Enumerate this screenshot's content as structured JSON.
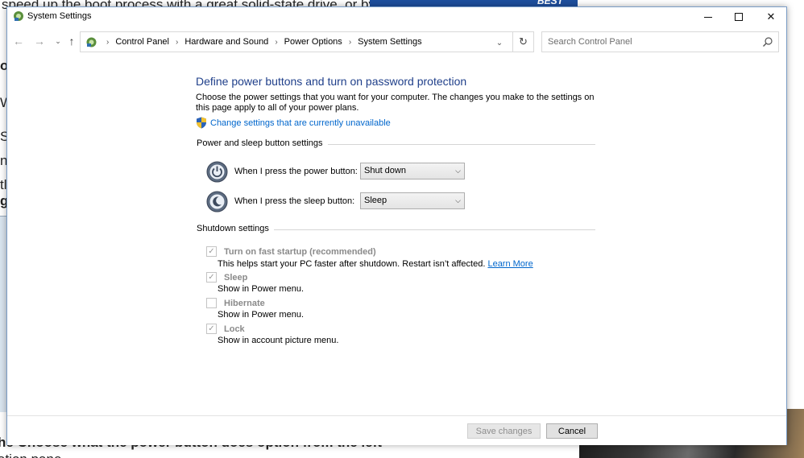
{
  "background": {
    "top_text": "speed up the boot process with a great solid-state drive, or by",
    "banner_text": "BEST",
    "bottom_line1": "he Choose what the power button does option from the left",
    "bottom_line2": "ation pane.",
    "left_fragments": [
      "o",
      "W",
      "S",
      "n",
      "tl",
      "gs"
    ]
  },
  "window": {
    "title": "System Settings",
    "controls": {
      "minimize": "minimize",
      "maximize": "maximize",
      "close": "✕"
    }
  },
  "nav": {
    "breadcrumbs": [
      "Control Panel",
      "Hardware and Sound",
      "Power Options",
      "System Settings"
    ],
    "search_placeholder": "Search Control Panel"
  },
  "main": {
    "title": "Define power buttons and turn on password protection",
    "description": "Choose the power settings that you want for your computer. The changes you make to the settings on this page apply to all of your power plans.",
    "change_link": "Change settings that are currently unavailable",
    "power_section": {
      "header": "Power and sleep button settings",
      "power_button_label": "When I press the power button:",
      "power_button_value": "Shut down",
      "sleep_button_label": "When I press the sleep button:",
      "sleep_button_value": "Sleep"
    },
    "shutdown_section": {
      "header": "Shutdown settings",
      "items": [
        {
          "label": "Turn on fast startup (recommended)",
          "desc": "This helps start your PC faster after shutdown. Restart isn’t affected.",
          "link": "Learn More",
          "checked": true
        },
        {
          "label": "Sleep",
          "desc": "Show in Power menu.",
          "checked": true
        },
        {
          "label": "Hibernate",
          "desc": "Show in Power menu.",
          "checked": false
        },
        {
          "label": "Lock",
          "desc": "Show in account picture menu.",
          "checked": true
        }
      ]
    }
  },
  "footer": {
    "save_label": "Save changes",
    "cancel_label": "Cancel"
  },
  "colors": {
    "title_blue": "#1f3f8a",
    "link_blue": "#0066cc",
    "disabled_gray": "#8a8a8a"
  }
}
